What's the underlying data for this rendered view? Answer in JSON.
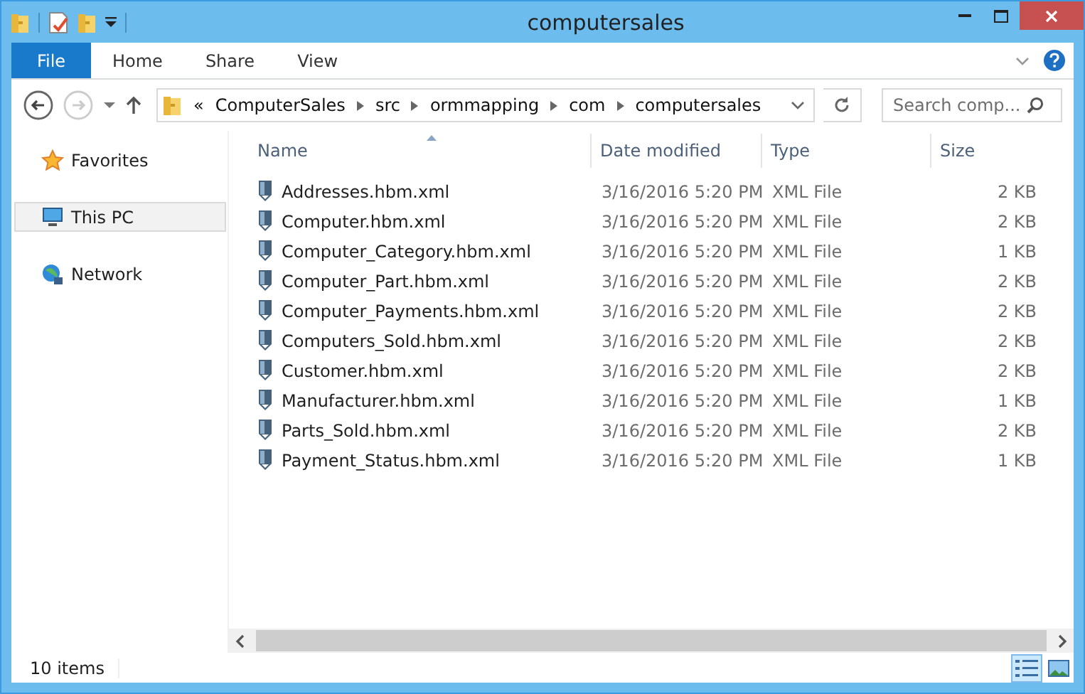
{
  "window": {
    "title": "computersales"
  },
  "ribbon": {
    "tabs": [
      {
        "label": "File",
        "kind": "file"
      },
      {
        "label": "Home",
        "kind": "tab"
      },
      {
        "label": "Share",
        "kind": "tab"
      },
      {
        "label": "View",
        "kind": "tab"
      }
    ]
  },
  "address": {
    "overflow": "«",
    "path": [
      "ComputerSales",
      "src",
      "ormmapping",
      "com",
      "computersales"
    ]
  },
  "search": {
    "placeholder": "Search comp..."
  },
  "sidebar": {
    "items": [
      {
        "label": "Favorites",
        "kind": "favorites",
        "selected": false
      },
      {
        "label": "This PC",
        "kind": "computer",
        "selected": true
      },
      {
        "label": "Network",
        "kind": "network",
        "selected": false
      }
    ]
  },
  "table": {
    "columns": [
      {
        "label": "Name",
        "sorted": true
      },
      {
        "label": "Date modified",
        "sorted": false
      },
      {
        "label": "Type",
        "sorted": false
      },
      {
        "label": "Size",
        "sorted": false
      }
    ],
    "rows": [
      {
        "name": "Addresses.hbm.xml",
        "date": "3/16/2016 5:20 PM",
        "type": "XML File",
        "size": "2 KB"
      },
      {
        "name": "Computer.hbm.xml",
        "date": "3/16/2016 5:20 PM",
        "type": "XML File",
        "size": "2 KB"
      },
      {
        "name": "Computer_Category.hbm.xml",
        "date": "3/16/2016 5:20 PM",
        "type": "XML File",
        "size": "1 KB"
      },
      {
        "name": "Computer_Part.hbm.xml",
        "date": "3/16/2016 5:20 PM",
        "type": "XML File",
        "size": "2 KB"
      },
      {
        "name": "Computer_Payments.hbm.xml",
        "date": "3/16/2016 5:20 PM",
        "type": "XML File",
        "size": "2 KB"
      },
      {
        "name": "Computers_Sold.hbm.xml",
        "date": "3/16/2016 5:20 PM",
        "type": "XML File",
        "size": "2 KB"
      },
      {
        "name": "Customer.hbm.xml",
        "date": "3/16/2016 5:20 PM",
        "type": "XML File",
        "size": "2 KB"
      },
      {
        "name": "Manufacturer.hbm.xml",
        "date": "3/16/2016 5:20 PM",
        "type": "XML File",
        "size": "1 KB"
      },
      {
        "name": "Parts_Sold.hbm.xml",
        "date": "3/16/2016 5:20 PM",
        "type": "XML File",
        "size": "2 KB"
      },
      {
        "name": "Payment_Status.hbm.xml",
        "date": "3/16/2016 5:20 PM",
        "type": "XML File",
        "size": "1 KB"
      }
    ]
  },
  "status_bar": {
    "text": "10 items",
    "views": [
      {
        "kind": "details",
        "selected": true
      },
      {
        "kind": "large",
        "selected": false
      }
    ]
  }
}
